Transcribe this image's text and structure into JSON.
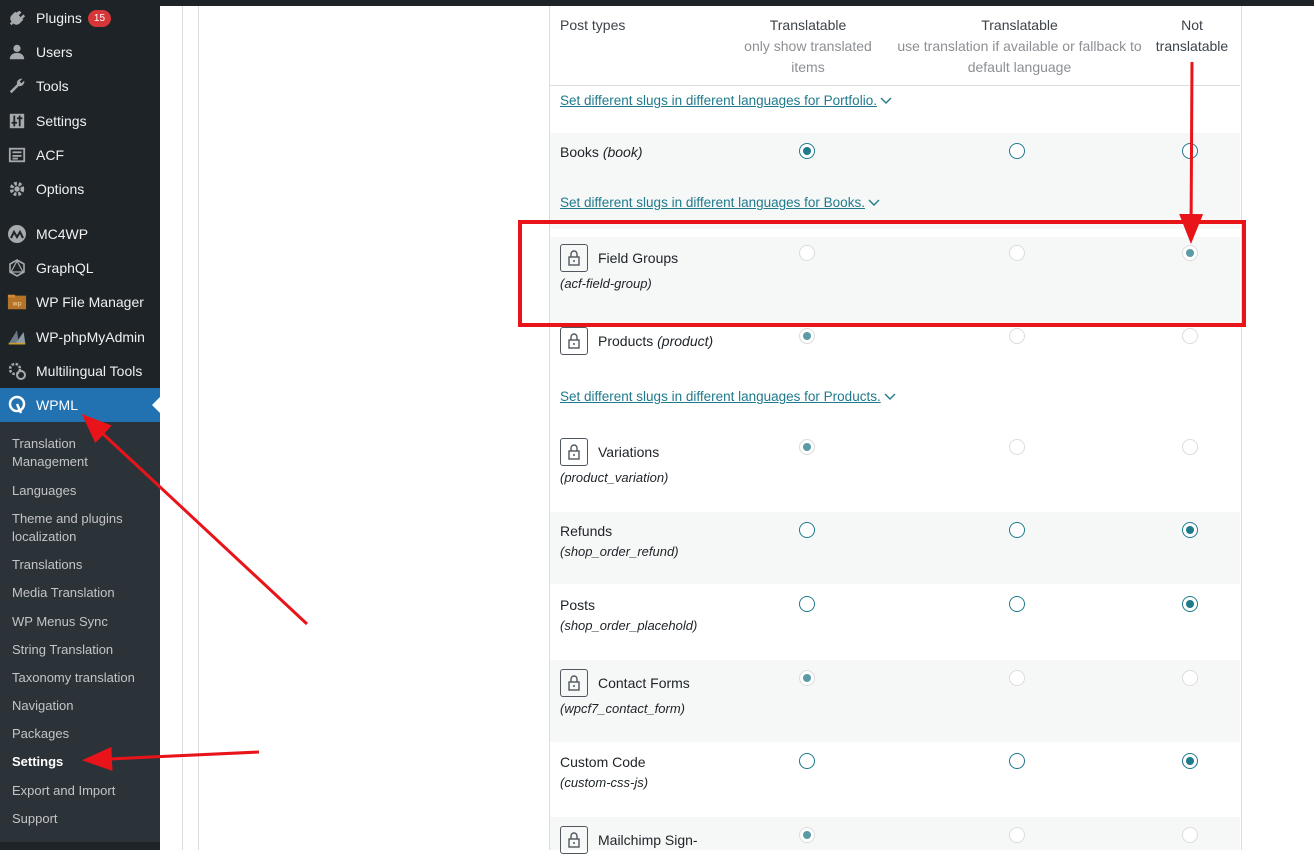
{
  "sidebar": {
    "items": [
      {
        "label": "Plugins",
        "icon": "plugin-icon",
        "badge": "15"
      },
      {
        "label": "Users",
        "icon": "users-icon"
      },
      {
        "label": "Tools",
        "icon": "wrench-icon"
      },
      {
        "label": "Settings",
        "icon": "settings-sliders-icon"
      },
      {
        "label": "ACF",
        "icon": "acf-icon"
      },
      {
        "label": "Options",
        "icon": "gear-icon"
      },
      {
        "label": "MC4WP",
        "icon": "mc4wp-icon"
      },
      {
        "label": "GraphQL",
        "icon": "graphql-icon"
      },
      {
        "label": "WP File Manager",
        "icon": "file-manager-icon"
      },
      {
        "label": "WP-phpMyAdmin",
        "icon": "phpmyadmin-icon"
      },
      {
        "label": "Multilingual Tools",
        "icon": "multilingual-tools-icon"
      },
      {
        "label": "WPML",
        "icon": "wpml-icon"
      }
    ],
    "submenu": [
      "Translation Management",
      "Languages",
      "Theme and plugins localization",
      "Translations",
      "Media Translation",
      "WP Menus Sync",
      "String Translation",
      "Taxonomy translation",
      "Navigation",
      "Packages",
      "Settings",
      "Export and Import",
      "Support"
    ]
  },
  "table": {
    "headers": {
      "post_types": "Post types",
      "col1_title": "Translatable",
      "col1_sub": "only show translated items",
      "col2_title": "Translatable",
      "col2_sub": "use translation if available or fallback to default language",
      "col3_title": "Not translatable"
    },
    "slug_links": {
      "portfolio": "Set different slugs in different languages for Portfolio.",
      "books": "Set different slugs in different languages for Books.",
      "products": "Set different slugs in different languages for Products."
    },
    "rows": [
      {
        "name": "Books",
        "slug": "(book)",
        "locked": false,
        "selected": 0
      },
      {
        "name": "Field Groups",
        "slug": "(acf-field-group)",
        "locked": true,
        "selected": 2
      },
      {
        "name": "Products",
        "slug": "(product)",
        "locked": true,
        "selected": 0
      },
      {
        "name": "Variations",
        "slug": "(product_variation)",
        "locked": true,
        "selected": 0
      },
      {
        "name": "Refunds",
        "slug": "(shop_order_refund)",
        "locked": false,
        "selected": 2
      },
      {
        "name": "Posts",
        "slug": "(shop_order_placehold)",
        "locked": false,
        "selected": 2
      },
      {
        "name": "Contact Forms",
        "slug": "(wpcf7_contact_form)",
        "locked": true,
        "selected": 0
      },
      {
        "name": "Custom Code",
        "slug": "(custom-css-js)",
        "locked": false,
        "selected": 2
      },
      {
        "name": "Mailchimp Sign-",
        "slug": "",
        "locked": true,
        "selected": 0
      }
    ]
  },
  "colors": {
    "sidebar_bg": "#1d2327",
    "submenu_bg": "#2c3338",
    "current_menu": "#2271b1",
    "radio_accent": "#1f7a8c",
    "annotation_red": "#e8141a"
  }
}
